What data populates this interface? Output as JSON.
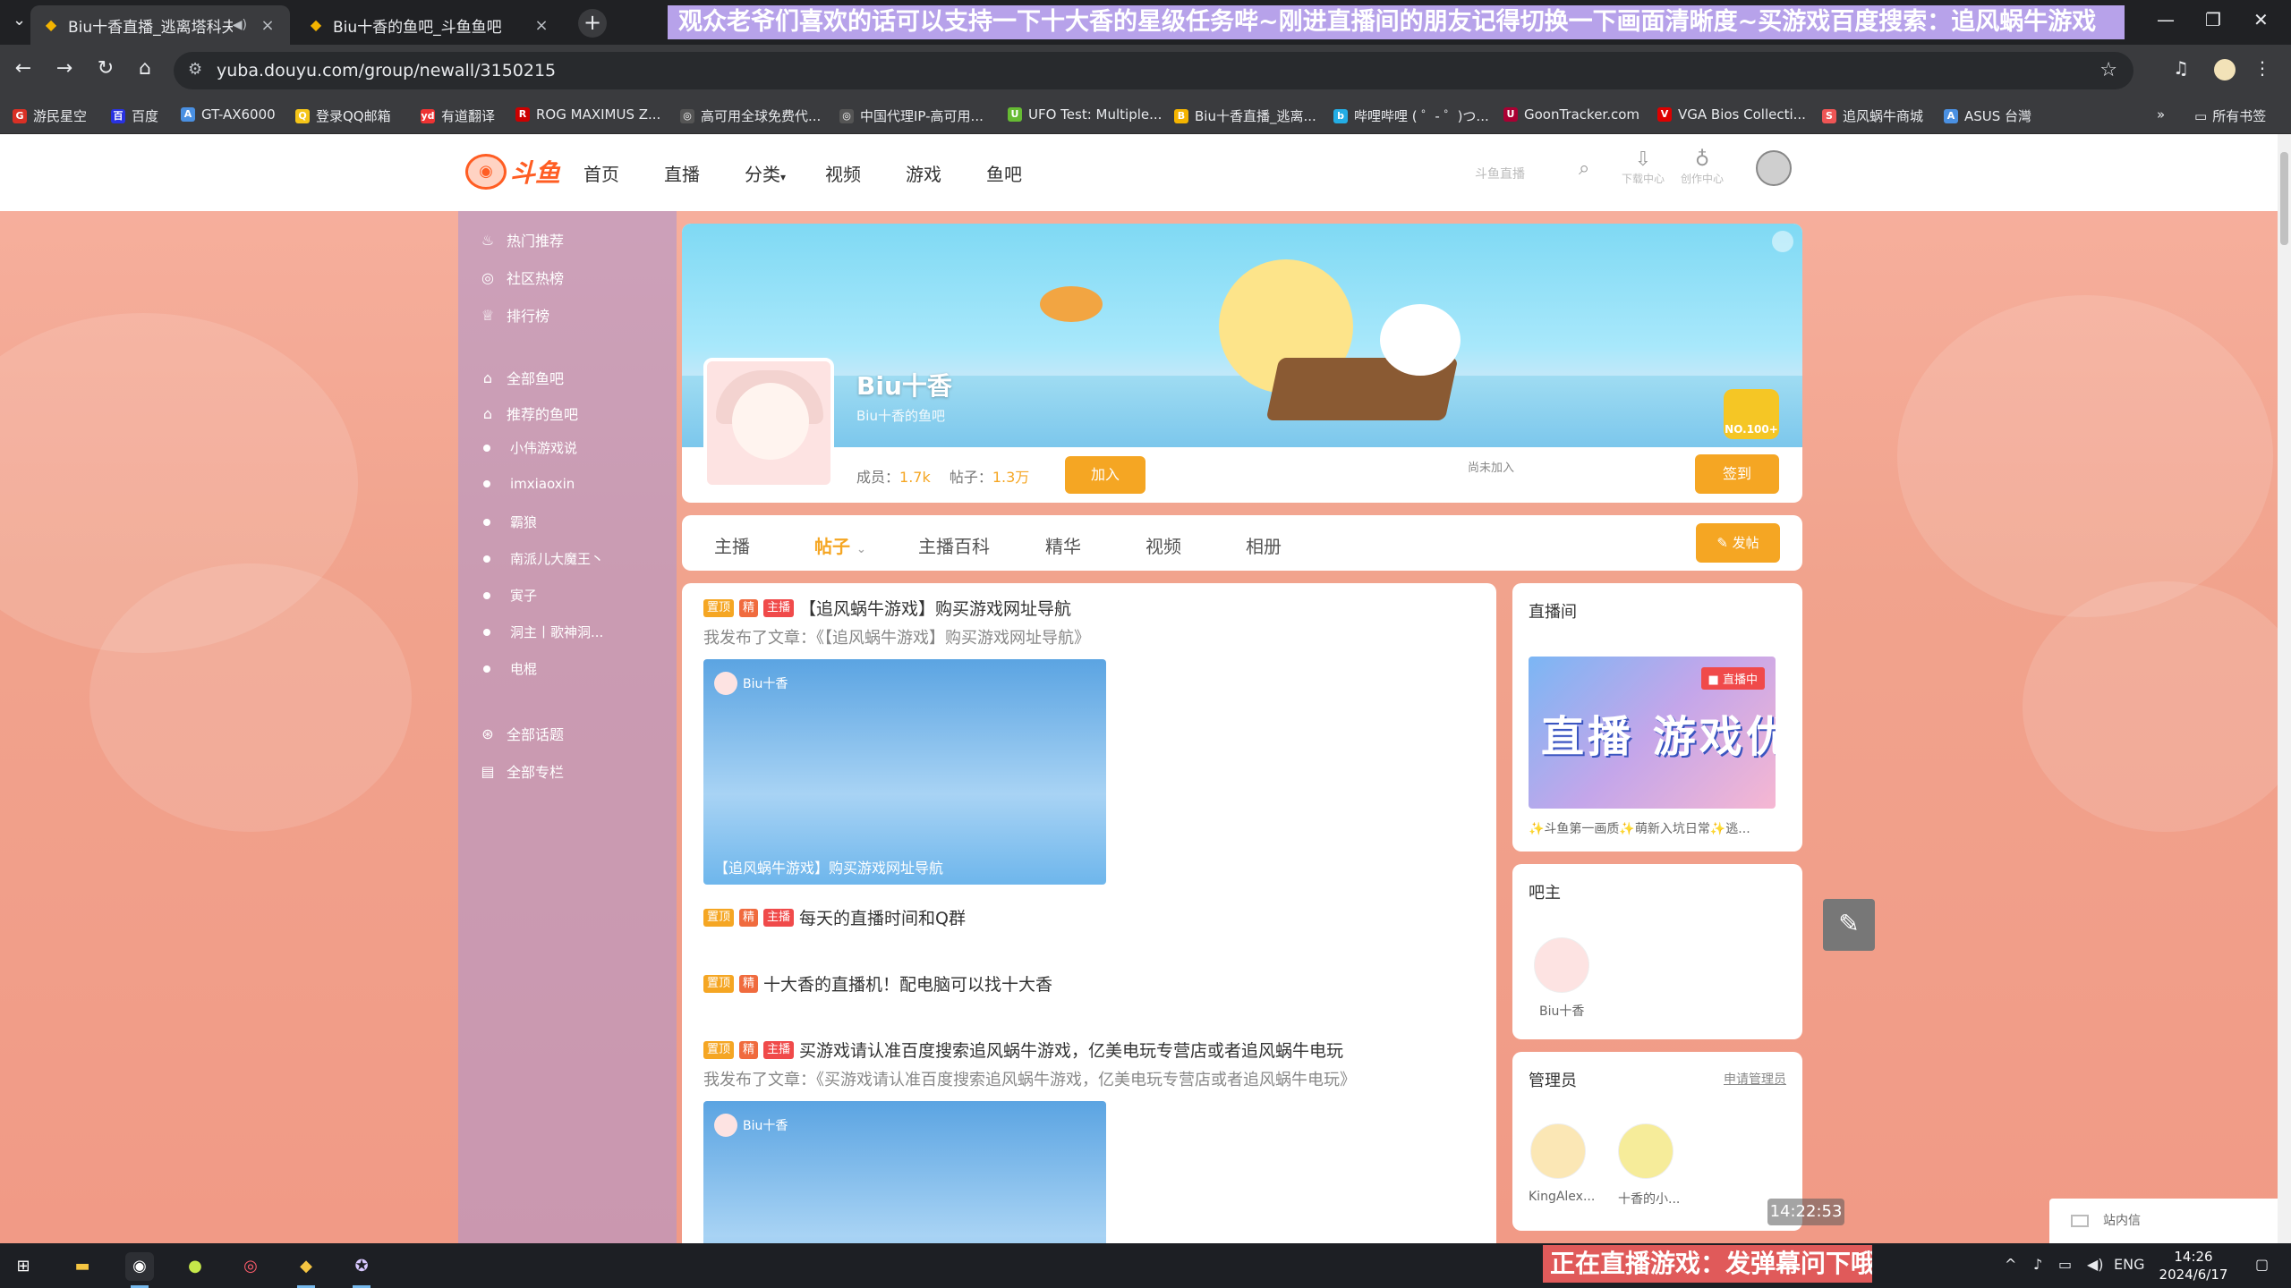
{
  "browser": {
    "tabs": [
      {
        "title": "Biu十香直播_逃离塔科夫直播_斗鱼",
        "active": true
      },
      {
        "title": "Biu十香的鱼吧_斗鱼鱼吧",
        "active": false
      }
    ],
    "url": "yuba.douyu.com/group/newall/3150215",
    "bookmarks": [
      {
        "label": "游民星空",
        "icon": "G",
        "color": "#d93025"
      },
      {
        "label": "百度",
        "icon": "百",
        "color": "#2932e1"
      },
      {
        "label": "GT-AX6000",
        "icon": "A",
        "color": "#4a90e2"
      },
      {
        "label": "登录QQ邮箱",
        "icon": "Q",
        "color": "#f5c518"
      },
      {
        "label": "有道翻译",
        "icon": "yd",
        "color": "#e33"
      },
      {
        "label": "ROG MAXIMUS Z...",
        "icon": "R",
        "color": "#c00"
      },
      {
        "label": "高可用全球免费代...",
        "icon": "◎",
        "color": "#555"
      },
      {
        "label": "中国代理IP-高可用...",
        "icon": "◎",
        "color": "#555"
      },
      {
        "label": "UFO Test: Multiple...",
        "icon": "U",
        "color": "#6b3"
      },
      {
        "label": "Biu十香直播_逃离...",
        "icon": "B",
        "color": "#f4b400"
      },
      {
        "label": "哔哩哔哩 ( ゜- ゜)つ...",
        "icon": "b",
        "color": "#23ade5"
      },
      {
        "label": "GoonTracker.com",
        "icon": "U",
        "color": "#a03"
      },
      {
        "label": "VGA Bios Collecti...",
        "icon": "V",
        "color": "#d00"
      },
      {
        "label": "追风蜗牛商城",
        "icon": "S",
        "color": "#e55"
      },
      {
        "label": "ASUS 台灣",
        "icon": "A",
        "color": "#4a90e2"
      }
    ],
    "all_bookmarks": "所有书签"
  },
  "overlay": {
    "top": "观众老爷们喜欢的话可以支持一下十大香的星级任务哔~刚进直播间的朋友记得切换一下画面清晰度~买游戏百度搜索：追风蜗牛游戏",
    "bottom": "正在直播游戏：发弹幕问下哦"
  },
  "header": {
    "logo": "斗鱼",
    "nav": [
      "首页",
      "直播",
      "分类",
      "视频",
      "游戏",
      "鱼吧"
    ],
    "search_label": "斗鱼直播",
    "download": "下载中心",
    "creator": "创作中心"
  },
  "sidebar": {
    "top": [
      "热门推荐",
      "社区热榜",
      "排行榜"
    ],
    "all_groups": "全部鱼吧",
    "recommended": "推荐的鱼吧",
    "groups": [
      "小伟游戏说",
      "imxiaoxin",
      "霸狼",
      "南派儿大魔王丶",
      "寅子",
      "洞主丨歌神洞...",
      "电棍"
    ],
    "bottom": [
      "全部话题",
      "全部专栏"
    ]
  },
  "banner": {
    "name": "Biu十香",
    "sub": "Biu十香的鱼吧",
    "members_label": "成员：",
    "members": "1.7k",
    "posts_label": "帖子：",
    "posts": "1.3万",
    "join": "加入",
    "not_joined": "尚未加入",
    "sign": "签到",
    "rank": "NO.100+"
  },
  "tabs": [
    "主播",
    "帖子",
    "主播百科",
    "精华",
    "视频",
    "相册"
  ],
  "post_button": "发帖",
  "posts": [
    {
      "tags": [
        "置顶",
        "精",
        "主播"
      ],
      "title": "【追风蜗牛游戏】购买游戏网址导航",
      "desc": "我发布了文章：《【追风蜗牛游戏】购买游戏网址导航》",
      "img_author": "Biu十香",
      "img_caption": "【追风蜗牛游戏】购买游戏网址导航"
    },
    {
      "tags": [
        "置顶",
        "精",
        "主播"
      ],
      "title": "每天的直播时间和Q群"
    },
    {
      "tags": [
        "置顶",
        "精"
      ],
      "title": "十大香的直播机！配电脑可以找十大香"
    },
    {
      "tags": [
        "置顶",
        "精",
        "主播"
      ],
      "title": "买游戏请认准百度搜索追风蜗牛游戏，亿美电玩专营店或者追风蜗牛电玩",
      "desc": "我发布了文章：《买游戏请认准百度搜索追风蜗牛游戏，亿美电玩专营店或者追风蜗牛电玩》",
      "img_author": "Biu十香"
    }
  ],
  "right": {
    "live": {
      "title": "直播间",
      "tag": "直播中",
      "thumb_text": "直播 游戏优惠",
      "desc": "✨斗鱼第一画质✨萌新入坑日常✨逃..."
    },
    "owner": {
      "title": "吧主",
      "name": "Biu十香"
    },
    "admins": {
      "title": "管理员",
      "apply": "申请管理员",
      "names": [
        "KingAlex...",
        "十香的小..."
      ]
    }
  },
  "floating": {
    "time": "14:22:53",
    "messages": "站内信"
  },
  "taskbar": {
    "lang": "ENG",
    "time": "14:26",
    "date": "2024/6/17"
  }
}
